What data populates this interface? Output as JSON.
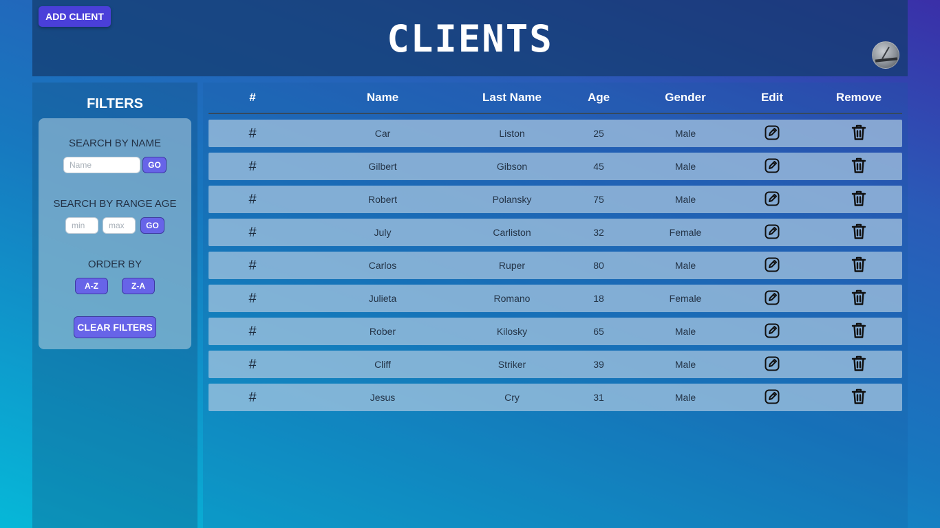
{
  "header": {
    "add_client_label": "ADD CLIENT",
    "title": "CLIENTS"
  },
  "sidebar": {
    "title": "FILTERS",
    "search_name": {
      "label": "SEARCH BY NAME",
      "placeholder": "Name",
      "go_label": "GO"
    },
    "search_age": {
      "label": "SEARCH BY RANGE AGE",
      "min_placeholder": "min",
      "max_placeholder": "max",
      "go_label": "GO"
    },
    "order": {
      "label": "ORDER BY",
      "az_label": "A-Z",
      "za_label": "Z-A"
    },
    "clear_label": "CLEAR FILTERS"
  },
  "table": {
    "headers": [
      "#",
      "Name",
      "Last Name",
      "Age",
      "Gender",
      "Edit",
      "Remove"
    ],
    "rows": [
      {
        "hash": "#",
        "name": "Car",
        "last_name": "Liston",
        "age": "25",
        "gender": "Male"
      },
      {
        "hash": "#",
        "name": "Gilbert",
        "last_name": "Gibson",
        "age": "45",
        "gender": "Male"
      },
      {
        "hash": "#",
        "name": "Robert",
        "last_name": "Polansky",
        "age": "75",
        "gender": "Male"
      },
      {
        "hash": "#",
        "name": "July",
        "last_name": "Carliston",
        "age": "32",
        "gender": "Female"
      },
      {
        "hash": "#",
        "name": "Carlos",
        "last_name": "Ruper",
        "age": "80",
        "gender": "Male"
      },
      {
        "hash": "#",
        "name": "Julieta",
        "last_name": "Romano",
        "age": "18",
        "gender": "Female"
      },
      {
        "hash": "#",
        "name": "Rober",
        "last_name": "Kilosky",
        "age": "65",
        "gender": "Male"
      },
      {
        "hash": "#",
        "name": "Cliff",
        "last_name": "Striker",
        "age": "39",
        "gender": "Male"
      },
      {
        "hash": "#",
        "name": "Jesus",
        "last_name": "Cry",
        "age": "31",
        "gender": "Male"
      }
    ]
  },
  "icons": {
    "edit": "edit-icon",
    "remove": "trash-icon",
    "avatar": "user-avatar"
  },
  "colors": {
    "accent": "#6764e8",
    "add_button": "#4a3fd9"
  }
}
